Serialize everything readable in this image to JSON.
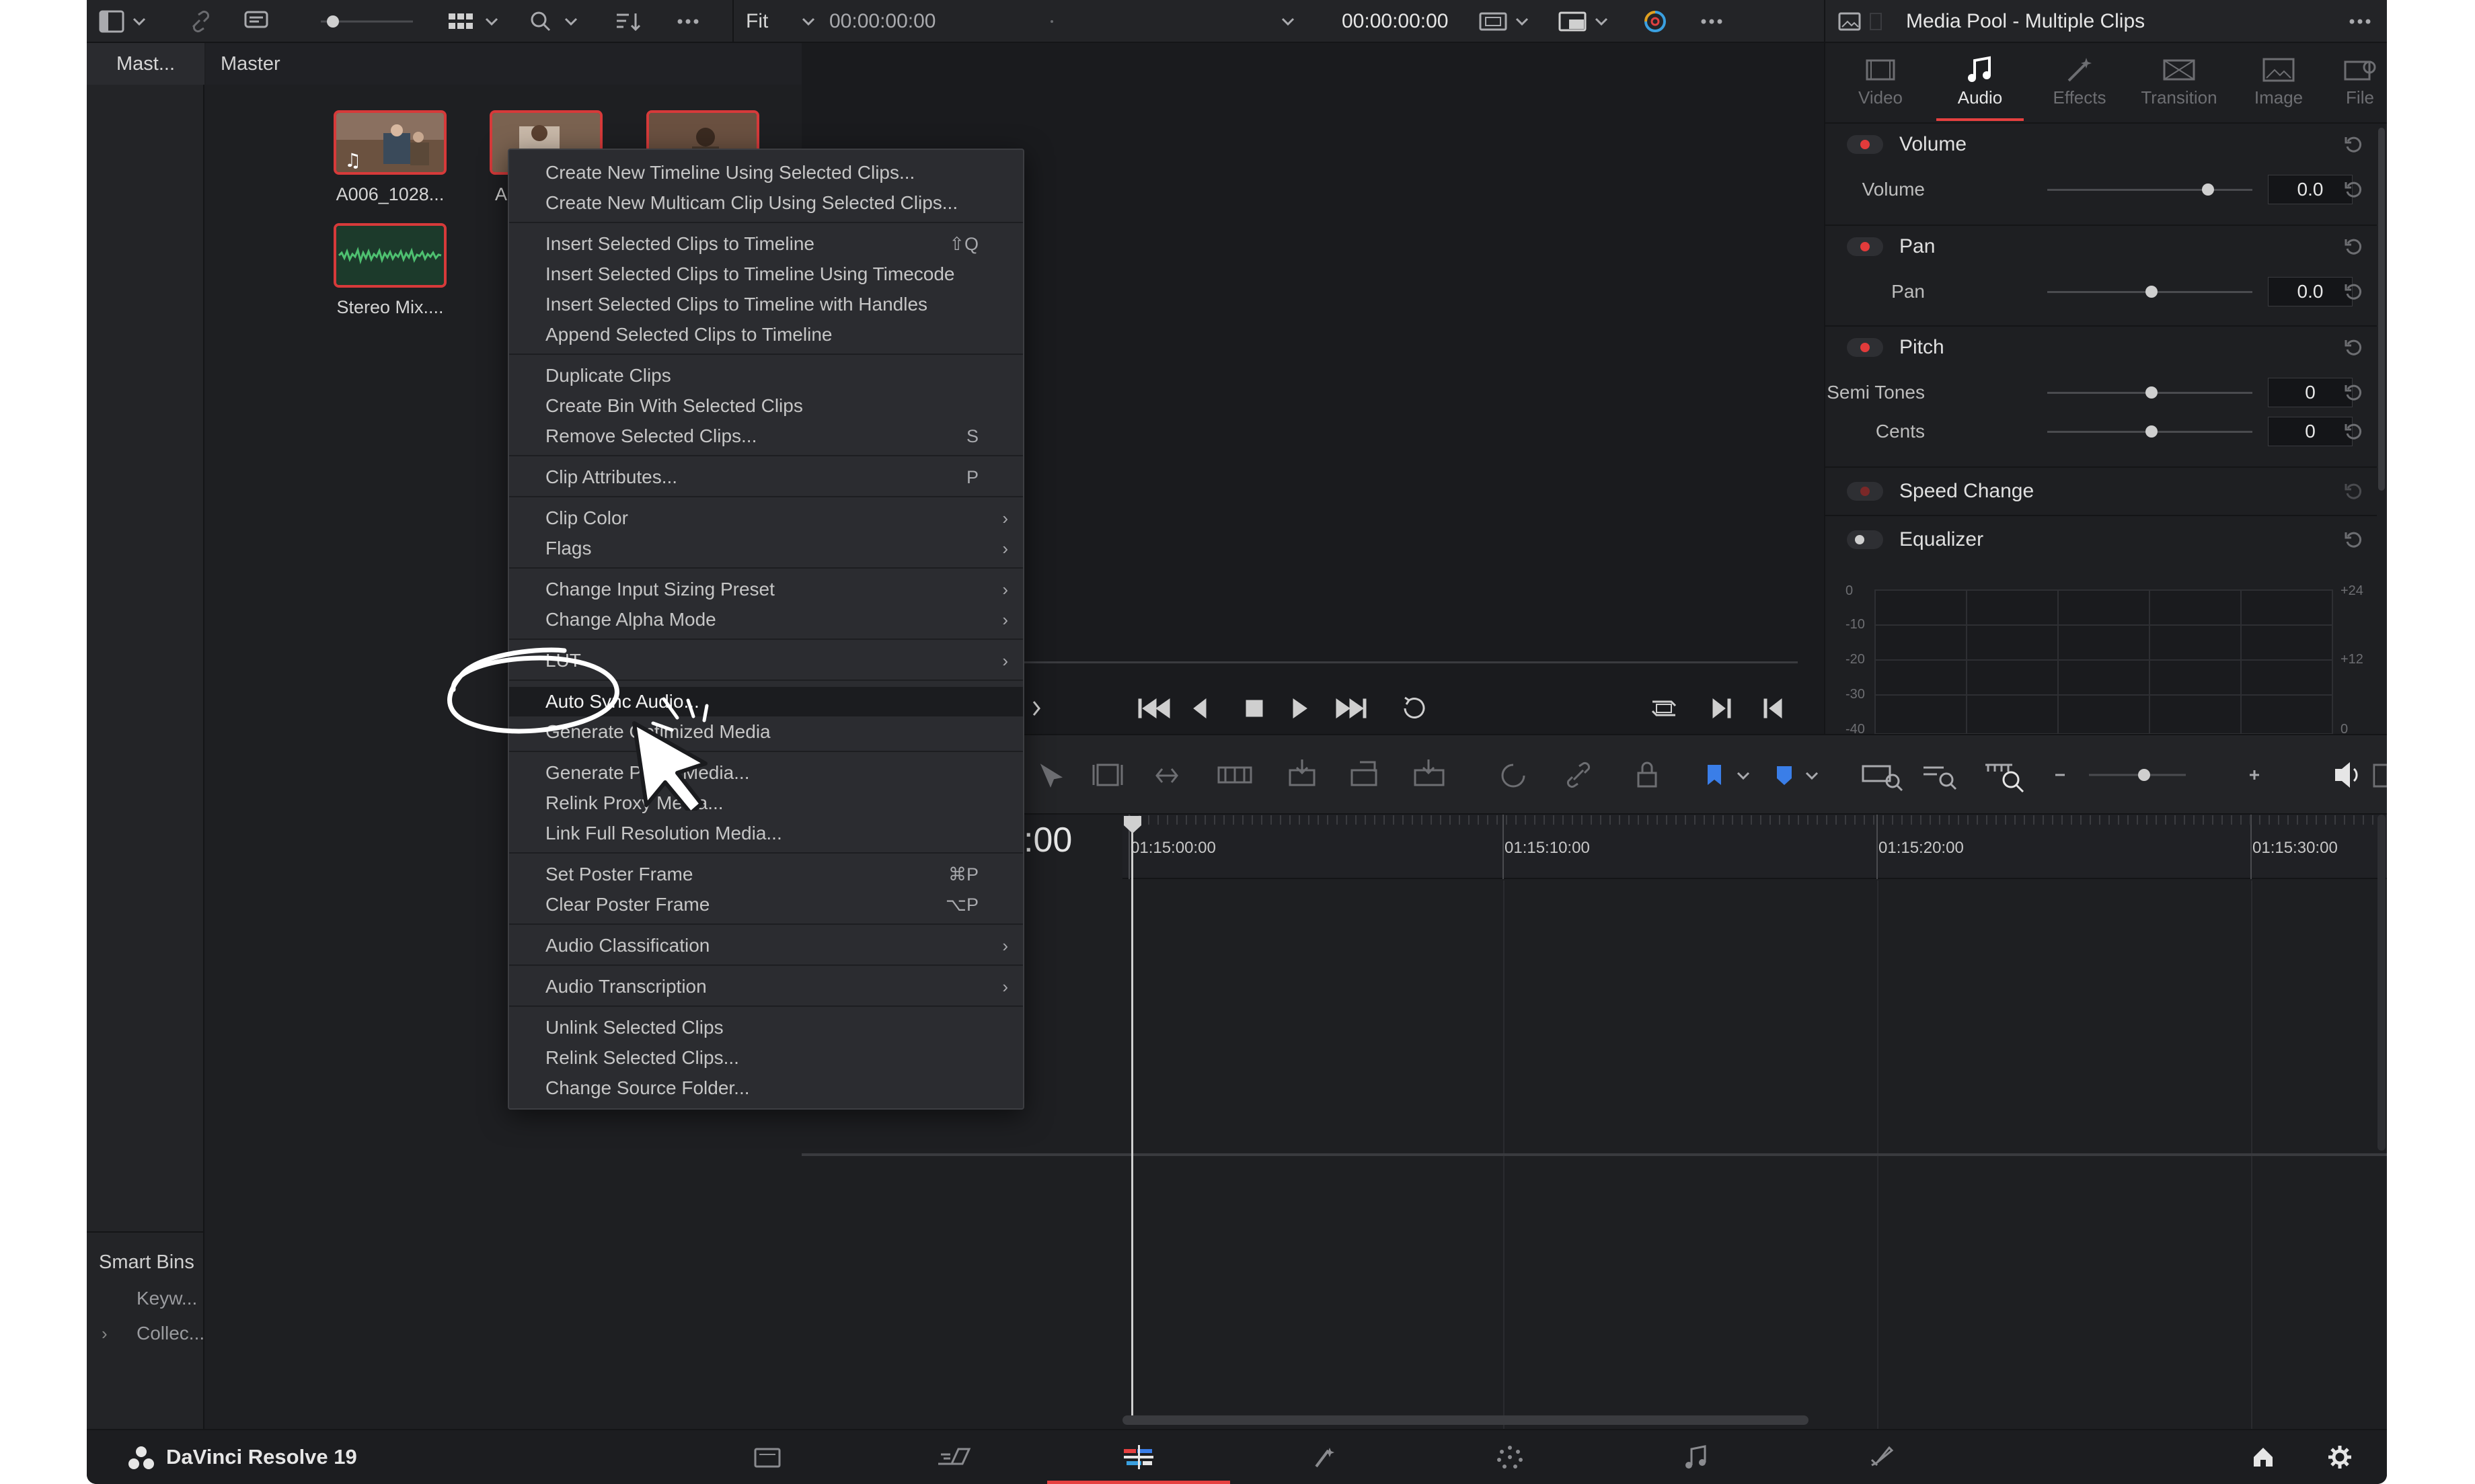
{
  "topbar": {
    "zoom_fit": "Fit",
    "source_timecode": "00:00:00:00",
    "program_timecode": "00:00:00:00",
    "inspector_title": "Media Pool - Multiple Clips"
  },
  "bins": {
    "master_tab": "Mast...",
    "smart_bins_title": "Smart Bins",
    "smart_bin_items": [
      "Keyw...",
      "Collec..."
    ]
  },
  "media_pool": {
    "header": "Master",
    "clips": [
      "A006_1028...",
      "A",
      "",
      "Stereo Mix...."
    ]
  },
  "inspector": {
    "tabs": [
      "Video",
      "Audio",
      "Effects",
      "Transition",
      "Image",
      "File"
    ],
    "active_tab": "Audio",
    "sections": {
      "volume": {
        "title": "Volume",
        "param": "Volume",
        "value": "0.0"
      },
      "pan": {
        "title": "Pan",
        "param": "Pan",
        "value": "0.0"
      },
      "pitch": {
        "title": "Pitch",
        "semitones_label": "Semi Tones",
        "semitones_value": "0",
        "cents_label": "Cents",
        "cents_value": "0"
      },
      "speed_change": {
        "title": "Speed Change"
      },
      "equalizer": {
        "title": "Equalizer",
        "y_left": [
          "0",
          "-10",
          "-20",
          "-30",
          "-40"
        ],
        "y_right": [
          "+24",
          "+12",
          "0"
        ]
      }
    }
  },
  "timeline": {
    "timecode_fragment": ":00",
    "ruler_marks": [
      "01:15:00:00",
      "01:15:10:00",
      "01:15:20:00",
      "01:15:30:00"
    ]
  },
  "context_menu": {
    "groups": [
      [
        {
          "label": "Create New Timeline Using Selected Clips..."
        },
        {
          "label": "Create New Multicam Clip Using Selected Clips..."
        }
      ],
      [
        {
          "label": "Insert Selected Clips to Timeline",
          "shortcut": "⇧Q"
        },
        {
          "label": "Insert Selected Clips to Timeline Using Timecode"
        },
        {
          "label": "Insert Selected Clips to Timeline with Handles"
        },
        {
          "label": "Append Selected Clips to Timeline"
        }
      ],
      [
        {
          "label": "Duplicate Clips"
        },
        {
          "label": "Create Bin With Selected Clips"
        },
        {
          "label": "Remove Selected Clips...",
          "shortcut": "S"
        }
      ],
      [
        {
          "label": "Clip Attributes...",
          "shortcut": "P"
        }
      ],
      [
        {
          "label": "Clip Color",
          "submenu": true
        },
        {
          "label": "Flags",
          "submenu": true
        }
      ],
      [
        {
          "label": "Change Input Sizing Preset",
          "submenu": true
        },
        {
          "label": "Change Alpha Mode",
          "submenu": true
        }
      ],
      [
        {
          "label": "LUT",
          "submenu": true
        }
      ],
      [
        {
          "label": "Auto Sync Audio...",
          "highlighted": true
        },
        {
          "label": "Generate Optimized Media"
        }
      ],
      [
        {
          "label": "Generate Proxy Media..."
        },
        {
          "label": "Relink Proxy Media..."
        },
        {
          "label": "Link Full Resolution Media..."
        }
      ],
      [
        {
          "label": "Set Poster Frame",
          "shortcut": "⌘P"
        },
        {
          "label": "Clear Poster Frame",
          "shortcut": "⌥P"
        }
      ],
      [
        {
          "label": "Audio Classification",
          "submenu": true
        }
      ],
      [
        {
          "label": "Audio Transcription",
          "submenu": true
        }
      ],
      [
        {
          "label": "Unlink Selected Clips"
        },
        {
          "label": "Relink Selected Clips..."
        },
        {
          "label": "Change Source Folder..."
        }
      ]
    ]
  },
  "bottombar": {
    "brand": "DaVinci Resolve 19",
    "pages": [
      "media-page",
      "cut-page",
      "edit-page",
      "fusion-page",
      "color-page",
      "fairlight-page",
      "deliver-page"
    ],
    "active_page": "edit-page"
  },
  "colors": {
    "accent": "#e64040",
    "bg": "#1e1f22",
    "panel": "#232427"
  }
}
